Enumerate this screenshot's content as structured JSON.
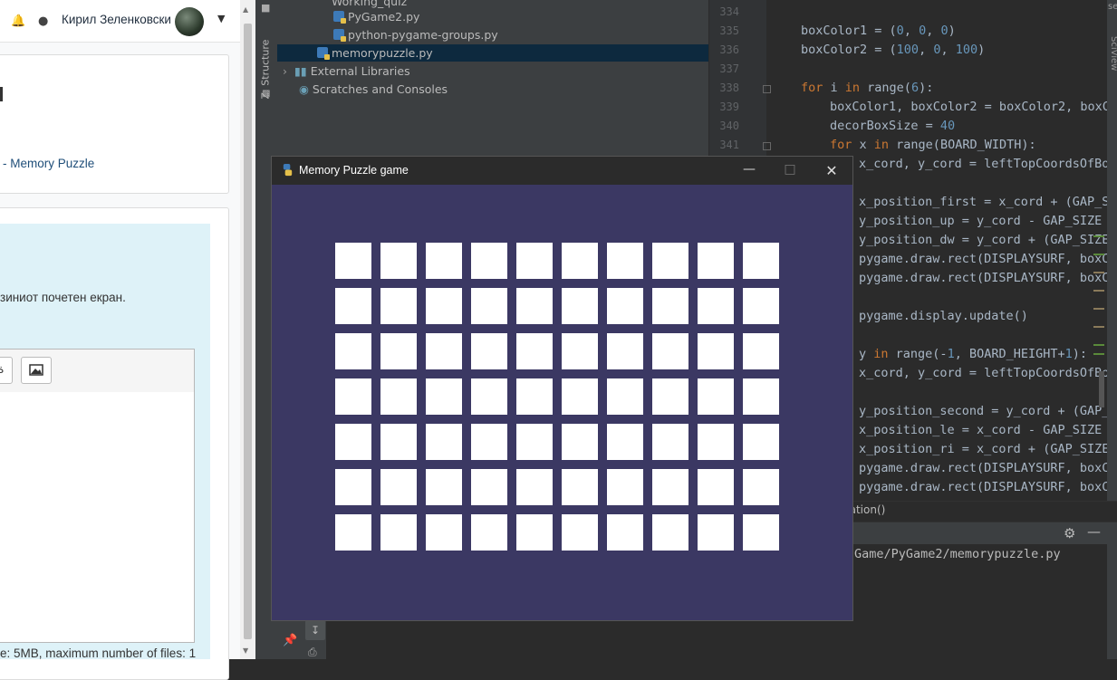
{
  "browser": {
    "user_name": "Кирил Зеленковски",
    "card_link": "- Memory Puzzle",
    "info_text": "зиниот почетен екран.",
    "toolbar_btn1": "ة",
    "file_note": "e: 5MB, maximum number of files: 1"
  },
  "ide": {
    "structure_tab": "Z: Structure",
    "right_tab": "SciView",
    "right_top": "se",
    "tree": [
      {
        "label": "Working_quiz"
      },
      {
        "label": "PyGame2.py"
      },
      {
        "label": "python-pygame-groups.py"
      },
      {
        "label": "memorypuzzle.py"
      },
      {
        "label": "External Libraries"
      },
      {
        "label": "Scratches and Consoles"
      }
    ],
    "line_numbers": [
      "334",
      "335",
      "336",
      "337",
      "338",
      "339",
      "340",
      "341"
    ],
    "breadcrumb": "nation()",
    "run_path": "Game/PyGame2/memorypuzzle.py"
  },
  "game": {
    "title": "Memory Puzzle game",
    "board_width": 10,
    "board_height": 7,
    "bg_color": "#3b3863",
    "box_color": "#ffffff"
  }
}
